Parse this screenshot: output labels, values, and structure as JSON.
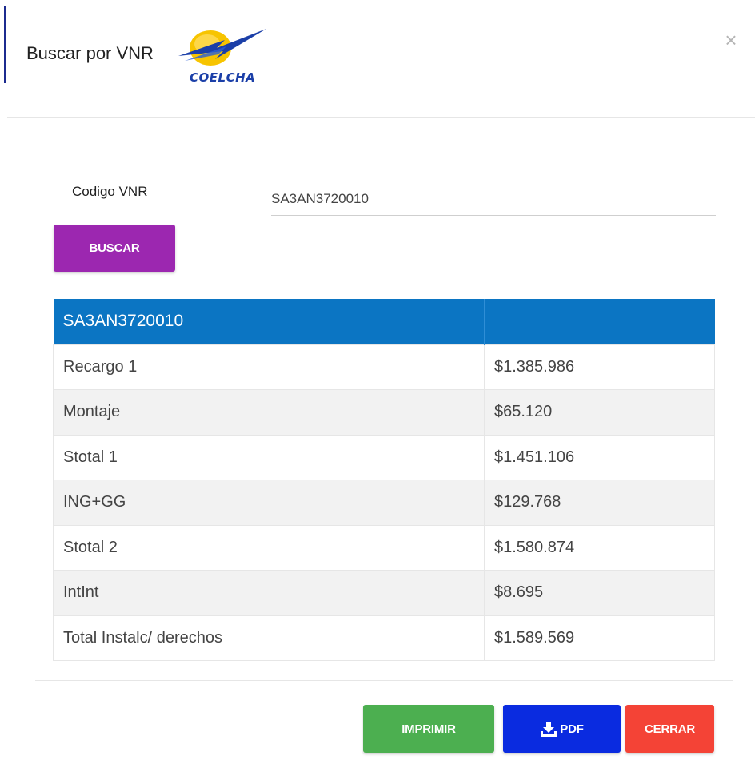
{
  "modal": {
    "title": "Buscar por VNR",
    "logo_text": "COELCHA",
    "close_label": "×"
  },
  "form": {
    "codigo_label": "Codigo VNR",
    "codigo_value": "SA3AN3720010",
    "buscar_label": "BUSCAR"
  },
  "results": {
    "header": [
      "SA3AN3720010",
      ""
    ],
    "rows": [
      {
        "label": "Recargo 1",
        "value": "$1.385.986"
      },
      {
        "label": "Montaje",
        "value": "$65.120"
      },
      {
        "label": "Stotal 1",
        "value": "$1.451.106"
      },
      {
        "label": "ING+GG",
        "value": "$129.768"
      },
      {
        "label": "Stotal 2",
        "value": "$1.580.874"
      },
      {
        "label": "IntInt",
        "value": "$8.695"
      },
      {
        "label": "Total Instalc/ derechos",
        "value": "$1.589.569"
      }
    ]
  },
  "footer": {
    "imprimir_label": "IMPRIMIR",
    "pdf_label": "PDF",
    "cerrar_label": "CERRAR"
  },
  "colors": {
    "buscar": "#9c27b0",
    "table_header": "#0b75c3",
    "imprimir": "#4caf50",
    "pdf": "#0a2be0",
    "cerrar": "#f44336"
  },
  "icons": {
    "pdf": "download-icon",
    "close": "close-icon"
  }
}
